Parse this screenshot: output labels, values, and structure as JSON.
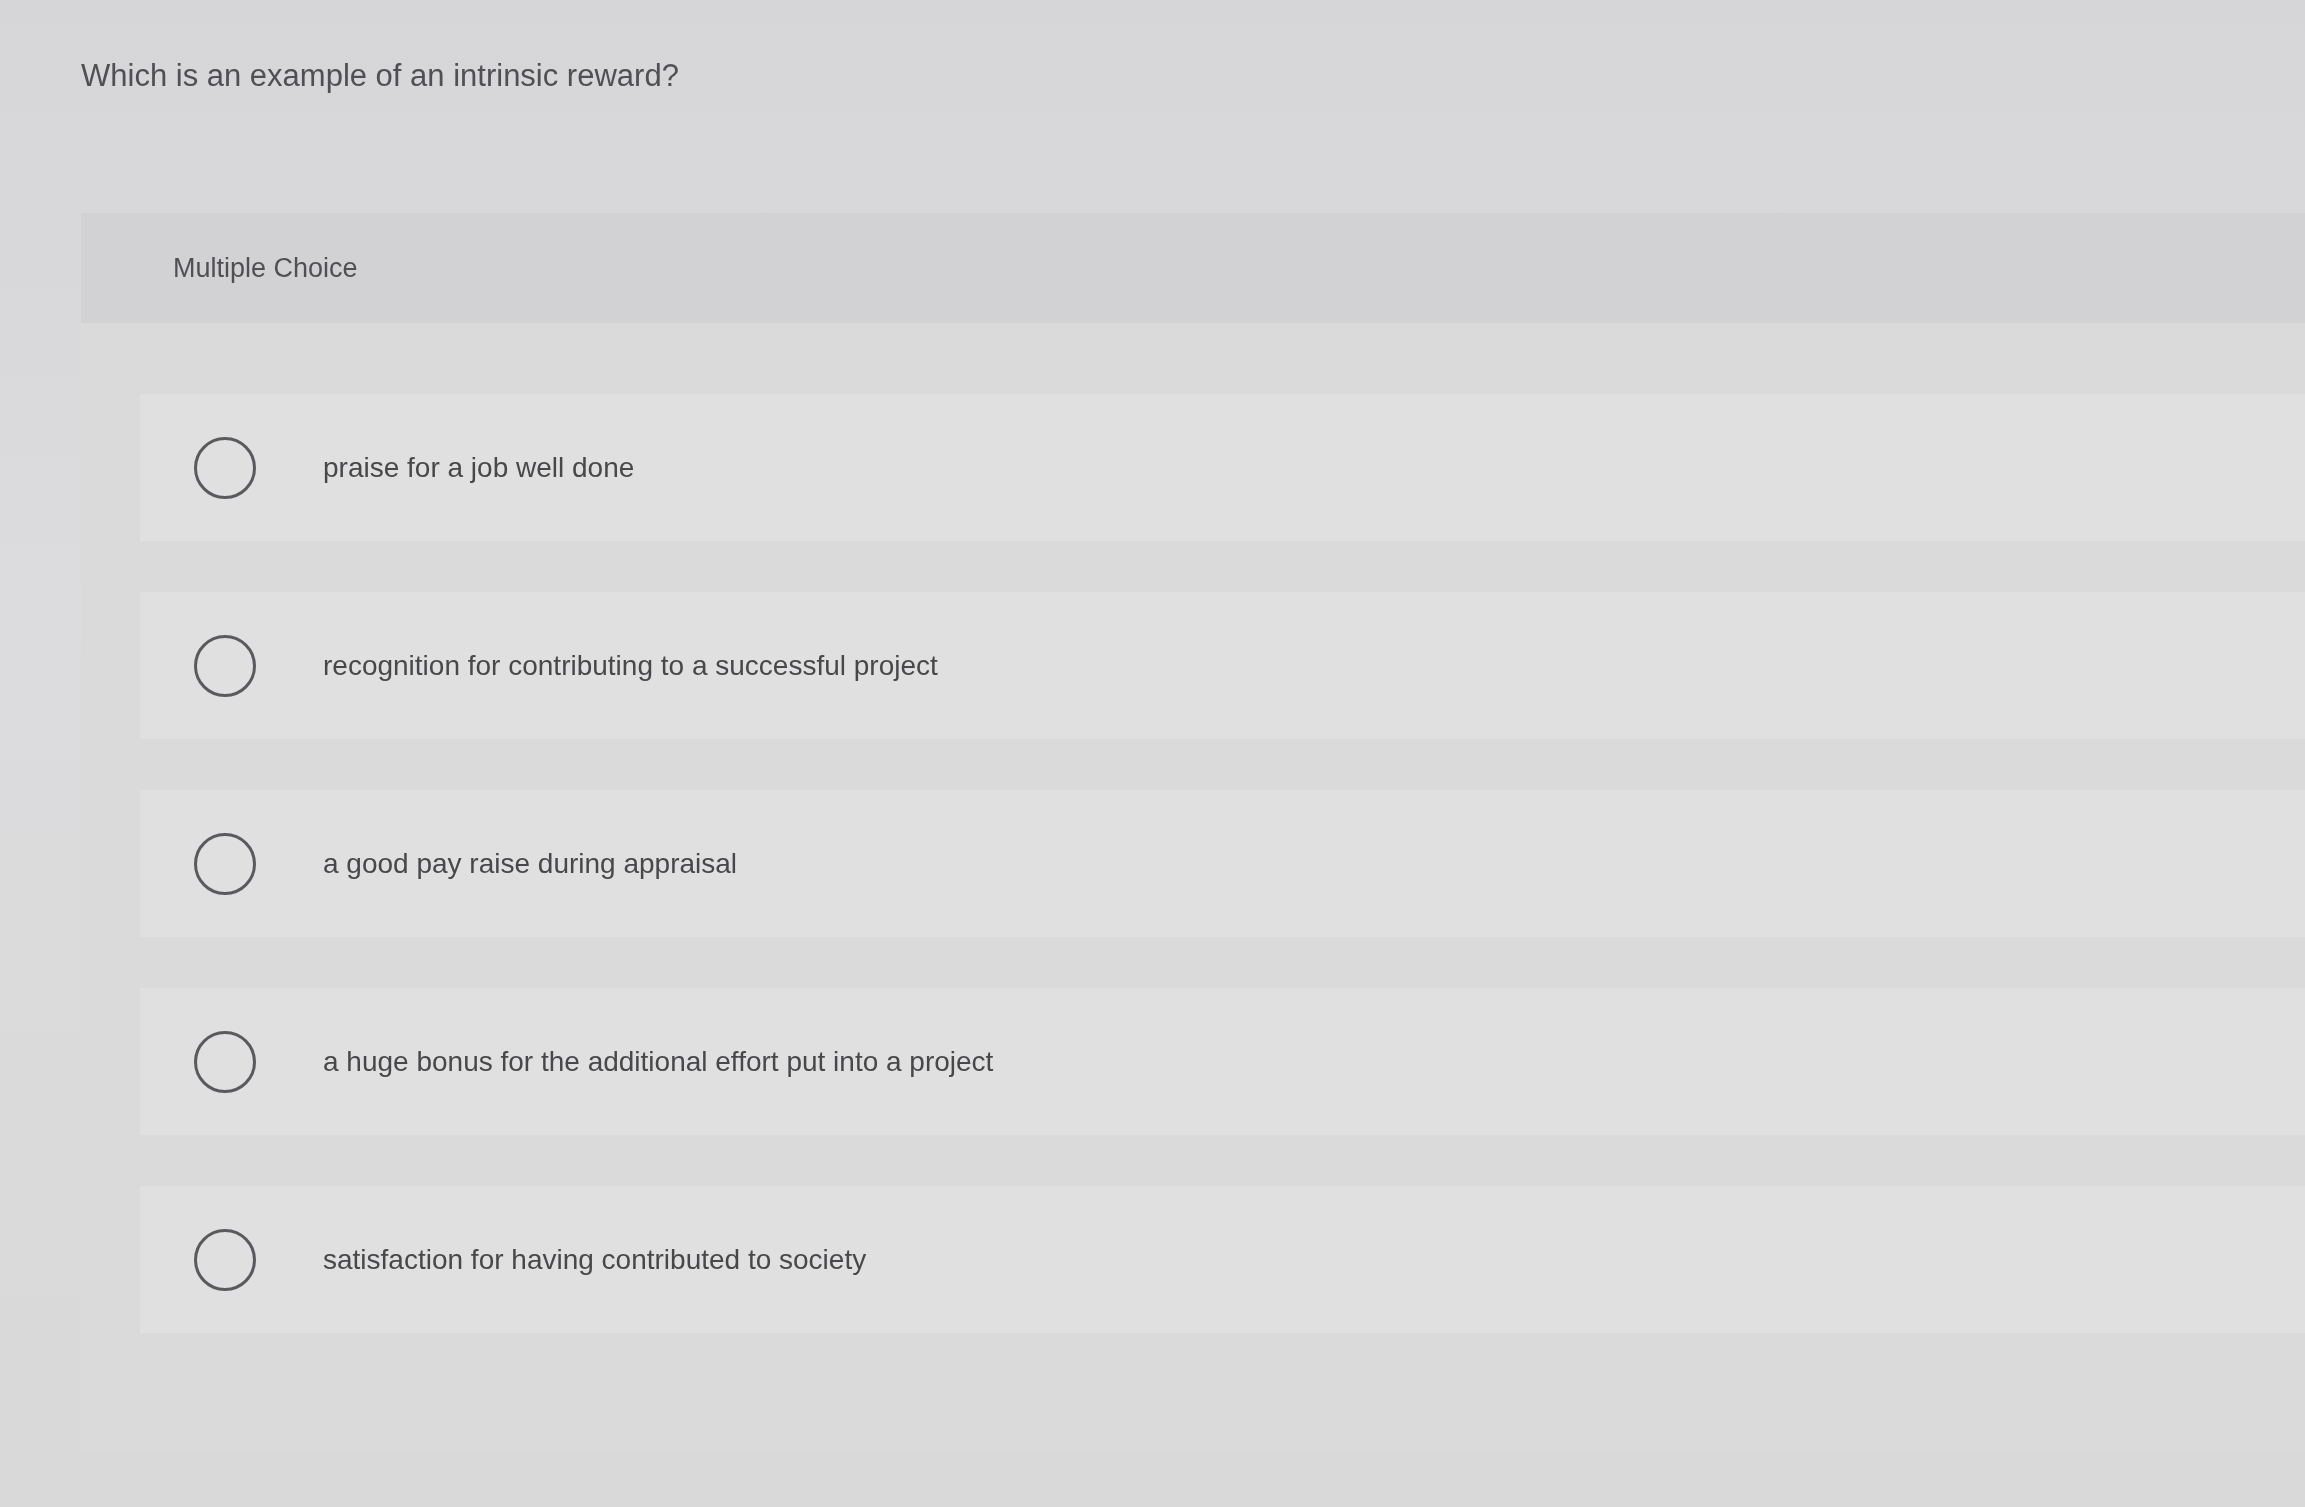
{
  "question": {
    "text": "Which is an example of an intrinsic reward?"
  },
  "answer_panel": {
    "type_label": "Multiple Choice",
    "options": [
      {
        "text": "praise for a job well done",
        "selected": false
      },
      {
        "text": "recognition for contributing to a successful project",
        "selected": false
      },
      {
        "text": "a good pay raise during appraisal",
        "selected": false
      },
      {
        "text": "a huge bonus for the additional effort put into a project",
        "selected": false
      },
      {
        "text": "satisfaction for having contributed to society",
        "selected": false
      }
    ]
  }
}
